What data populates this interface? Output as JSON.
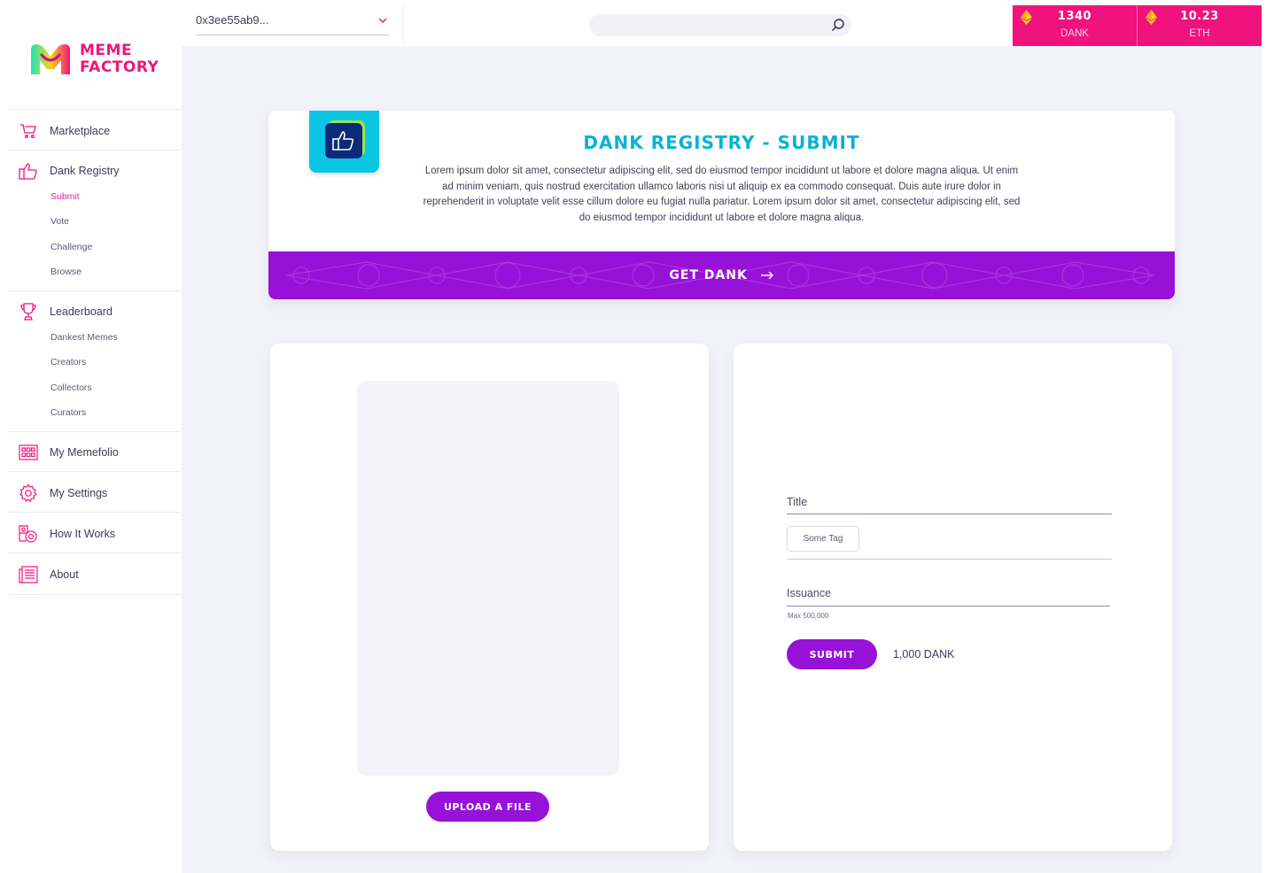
{
  "brand": {
    "line1": "MEME",
    "line2": "FACTORY"
  },
  "topbar": {
    "account": "0x3ee55ab9...",
    "search_placeholder": "",
    "balances": [
      {
        "value": "1340",
        "unit": "DANK"
      },
      {
        "value": "10.23",
        "unit": "ETH"
      }
    ]
  },
  "sidebar": {
    "marketplace": "Marketplace",
    "dank_registry": "Dank Registry",
    "registry_sub": [
      "Submit",
      "Vote",
      "Challenge",
      "Browse"
    ],
    "leaderboard": "Leaderboard",
    "leaderboard_sub": [
      "Dankest Memes",
      "Creators",
      "Collectors",
      "Curators"
    ],
    "memefolio": "My Memefolio",
    "settings": "My Settings",
    "how": "How It Works",
    "about": "About"
  },
  "header": {
    "title": "DANK REGISTRY - SUBMIT",
    "description": "Lorem ipsum dolor sit amet, consectetur adipiscing elit, sed do eiusmod tempor incididunt ut labore et dolore magna aliqua. Ut enim ad minim veniam, quis nostrud exercitation ullamco laboris nisi ut aliquip ex ea commodo consequat. Duis aute irure dolor in reprehenderit in voluptate velit esse cillum dolore eu fugiat nulla pariatur. Lorem ipsum dolor sit amet, consectetur adipiscing elit, sed do eiusmod tempor incididunt ut labore et dolore magna aliqua.",
    "banner_label": "GET DANK"
  },
  "upload": {
    "button_label": "UPLOAD A FILE"
  },
  "form": {
    "title_label": "Title",
    "tag_chip": "Some Tag",
    "issuance_label": "Issuance",
    "issuance_hint": "Max 500,000",
    "submit_label": "SUBMIT",
    "price": "1,000 DANK"
  },
  "colors": {
    "accent_purple": "#9712d8",
    "accent_pink": "#f0127e",
    "title_cyan": "#08b3d5",
    "active_link": "#e0289b"
  }
}
